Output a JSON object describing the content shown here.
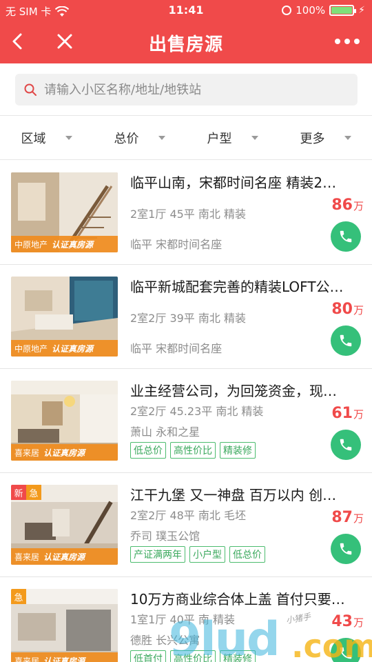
{
  "status_bar": {
    "carrier": "无 SIM 卡",
    "time": "11:41",
    "battery": "100%",
    "battery_color": "#7fe07a"
  },
  "header": {
    "title": "出售房源",
    "background_color": "#f04a4a",
    "back_icon": "chevron-left-icon",
    "close_icon": "close-icon",
    "more_icon": "more-dots-icon"
  },
  "search": {
    "placeholder": "请输入小区名称/地址/地铁站",
    "value": "",
    "icon": "search-icon"
  },
  "filters": [
    {
      "label": "区域"
    },
    {
      "label": "总价"
    },
    {
      "label": "户型"
    },
    {
      "label": "更多"
    }
  ],
  "listings": [
    {
      "title": "临平山南，宋都时间名座 精装2…",
      "spec": "2室1厅  45平  南北  精装",
      "location": "临平  宋都时间名座",
      "price": "86",
      "unit": "万",
      "agency": "中原地产",
      "verify": "认证真房源",
      "tags": [],
      "flags": []
    },
    {
      "title": "临平新城配套完善的精装LOFT公…",
      "spec": "2室2厅  39平  南北  精装",
      "location": "临平  宋都时间名座",
      "price": "80",
      "unit": "万",
      "agency": "中原地产",
      "verify": "认证真房源",
      "tags": [],
      "flags": []
    },
    {
      "title": "业主经营公司，为回笼资金，现…",
      "spec": "2室2厅  45.23平  南北  精装",
      "location": "萧山  永和之星",
      "price": "61",
      "unit": "万",
      "agency": "喜来居",
      "verify": "认证真房源",
      "tags": [
        "低总价",
        "高性价比",
        "精装修"
      ],
      "flags": []
    },
    {
      "title": "江干九堡 又一神盘 百万以内 创…",
      "spec": "2室2厅  48平  南北  毛坯",
      "location": "乔司  璞玉公馆",
      "price": "87",
      "unit": "万",
      "agency": "喜来居",
      "verify": "认证真房源",
      "tags": [
        "产证满两年",
        "小户型",
        "低总价"
      ],
      "flags": [
        "新",
        "急"
      ]
    },
    {
      "title": "10万方商业综合体上盖 首付只要…",
      "spec": "1室1厅  40平  南  精装",
      "location": "德胜  长兴公寓",
      "price": "43",
      "unit": "万",
      "agency": "喜来居",
      "verify": "认证真房源",
      "tags": [
        "低首付",
        "高性价比",
        "精装修"
      ],
      "flags": [
        "急"
      ]
    }
  ],
  "watermark": {
    "brand": "9lud",
    "suffix": ".com",
    "small": "小猪手"
  },
  "colors": {
    "price": "#f04a4a",
    "call_button": "#35c07a",
    "tag_border": "#4cbc6e",
    "banner": "#f08c1e"
  }
}
